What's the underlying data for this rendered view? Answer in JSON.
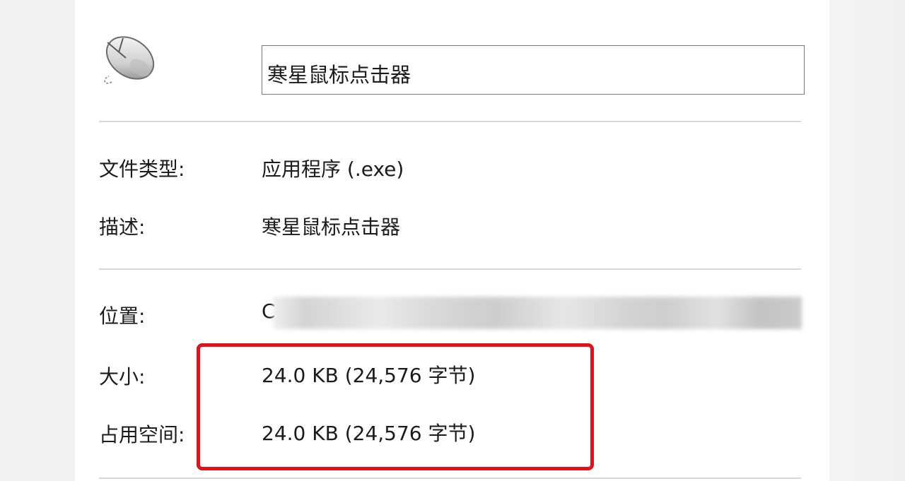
{
  "file": {
    "name": "寒星鼠标点击器",
    "icon": "mouse-icon"
  },
  "properties": {
    "type_label": "文件类型:",
    "type_value": "应用程序 (.exe)",
    "description_label": "描述:",
    "description_value": "寒星鼠标点击器",
    "location_label": "位置:",
    "location_value_visible": "C",
    "size_label": "大小:",
    "size_value": "24.0 KB (24,576 字节)",
    "disk_label": "占用空间:",
    "disk_value": "24.0 KB (24,576 字节)"
  },
  "colors": {
    "highlight": "#e0131a",
    "divider": "#d8d8d8"
  }
}
